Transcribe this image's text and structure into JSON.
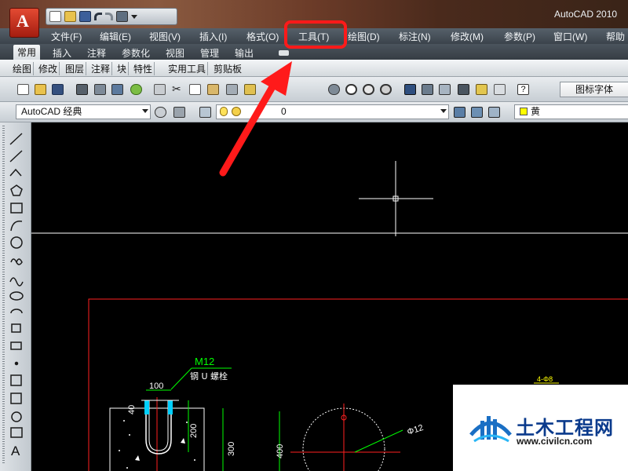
{
  "window": {
    "title": "AutoCAD 2010"
  },
  "menu": [
    {
      "label": "文件(F)"
    },
    {
      "label": "编辑(E)"
    },
    {
      "label": "视图(V)"
    },
    {
      "label": "插入(I)"
    },
    {
      "label": "格式(O)"
    },
    {
      "label": "工具(T)"
    },
    {
      "label": "绘图(D)"
    },
    {
      "label": "标注(N)"
    },
    {
      "label": "修改(M)"
    },
    {
      "label": "参数(P)"
    },
    {
      "label": "窗口(W)"
    },
    {
      "label": "帮助"
    }
  ],
  "ribbon_tabs": [
    {
      "label": "常用"
    },
    {
      "label": "插入"
    },
    {
      "label": "注释"
    },
    {
      "label": "参数化"
    },
    {
      "label": "视图"
    },
    {
      "label": "管理"
    },
    {
      "label": "输出"
    }
  ],
  "panels": [
    {
      "label": "绘图"
    },
    {
      "label": "修改"
    },
    {
      "label": "图层"
    },
    {
      "label": "注释"
    },
    {
      "label": "块"
    },
    {
      "label": "特性"
    },
    {
      "label": "实用工具"
    },
    {
      "label": "剪贴板"
    }
  ],
  "toolbar": {
    "text_style": "图标字体"
  },
  "workspace": {
    "value": "AutoCAD 经典"
  },
  "layer": {
    "value": "0"
  },
  "color": {
    "value": "黄",
    "swatch": "#ffff00"
  },
  "drawing": {
    "label_m12": "M12",
    "label_u_bolt": "钢 U 螺栓",
    "dim_100": "100",
    "dim_40": "40",
    "dim_200": "200",
    "dim_300": "300",
    "dim_400": "400",
    "label_phi12": "Φ12",
    "label_hole": "4-Φ8"
  },
  "watermark": {
    "title": "土木工程网",
    "url": "www.civilcn.com"
  },
  "colors": {
    "highlight": "#ff1a1a",
    "crosshair": "#ffffff",
    "border": "#ff2020",
    "dimension": "#00ff00"
  }
}
